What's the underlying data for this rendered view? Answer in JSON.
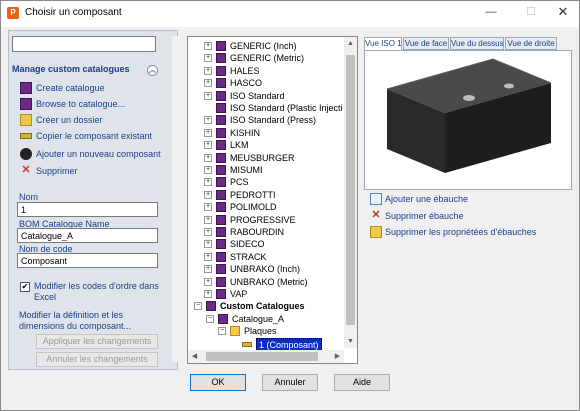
{
  "window": {
    "title": "Choisir un composant",
    "minimize": "—",
    "maximize": "☐",
    "close": "✕"
  },
  "left": {
    "search": {
      "value": "",
      "placeholder": ""
    },
    "manage_title": "Manage custom catalogues",
    "actions": [
      {
        "label": "Create catalogue",
        "icon": "catalogue-book-icon"
      },
      {
        "label": "Browse to catalogue...",
        "icon": "catalogue-book-icon"
      },
      {
        "label": "Créer un dossier",
        "icon": "folder-icon"
      },
      {
        "label": "Copier le composant existant",
        "icon": "component-link-icon"
      },
      {
        "label": "Ajouter un nouveau composant",
        "icon": "add-component-icon"
      },
      {
        "label": "Supprimer",
        "icon": "delete-icon"
      }
    ],
    "fields": {
      "nom_label": "Nom",
      "nom_value": "1",
      "bom_label": "BOM Catalogue Name",
      "bom_value": "Catalogue_A",
      "code_label": "Nom de code",
      "code_value": "Composant"
    },
    "checkbox_label": "Modifier les codes d'ordre dans Excel",
    "checkbox_checked": "✔",
    "modify_text": "Modifier la définition et les dimensions du composant...",
    "apply_label": "Appliquer les changements",
    "cancel_label": "Annuler les changements"
  },
  "tree": {
    "items": [
      {
        "label": "GENERIC (Inch)",
        "expand": "+"
      },
      {
        "label": "GENERIC (Metric)",
        "expand": "+"
      },
      {
        "label": "HALES",
        "expand": "+"
      },
      {
        "label": "HASCO",
        "expand": "+"
      },
      {
        "label": "ISO Standard",
        "expand": "+"
      },
      {
        "label": "ISO Standard (Plastic Injecti",
        "expand": ""
      },
      {
        "label": "ISO Standard (Press)",
        "expand": "+"
      },
      {
        "label": "KISHIN",
        "expand": "+"
      },
      {
        "label": "LKM",
        "expand": "+"
      },
      {
        "label": "MEUSBURGER",
        "expand": "+"
      },
      {
        "label": "MISUMI",
        "expand": "+"
      },
      {
        "label": "PCS",
        "expand": "+"
      },
      {
        "label": "PEDROTTI",
        "expand": "+"
      },
      {
        "label": "POLIMOLD",
        "expand": "+"
      },
      {
        "label": "PROGRESSIVE",
        "expand": "+"
      },
      {
        "label": "RABOURDIN",
        "expand": "+"
      },
      {
        "label": "SIDECO",
        "expand": "+"
      },
      {
        "label": "STRACK",
        "expand": "+"
      },
      {
        "label": "UNBRAKO (Inch)",
        "expand": "+"
      },
      {
        "label": "UNBRAKO (Metric)",
        "expand": "+"
      },
      {
        "label": "VAP",
        "expand": "+"
      }
    ],
    "custom": {
      "label": "Custom Catalogues",
      "expand": "−",
      "catalogue": {
        "label": "Catalogue_A",
        "expand": "−"
      },
      "folder": {
        "label": "Plaques",
        "expand": "−"
      },
      "component": {
        "label": "1 (Composant)"
      }
    },
    "scroll_up": "▲",
    "scroll_down": "▼",
    "scroll_left": "◀",
    "scroll_right": "▶"
  },
  "preview": {
    "tabs": [
      "Vue ISO 1",
      "Vue de face",
      "Vue du dessus",
      "Vue de droite"
    ],
    "actions": [
      {
        "label": "Ajouter une ébauche",
        "icon": "add-blank-icon"
      },
      {
        "label": "Supprimer ébauche",
        "icon": "delete-icon"
      },
      {
        "label": "Supprimer les propriétées d'ébauches",
        "icon": "delete-properties-icon"
      }
    ]
  },
  "buttons": {
    "ok": "OK",
    "cancel": "Annuler",
    "help": "Aide"
  }
}
